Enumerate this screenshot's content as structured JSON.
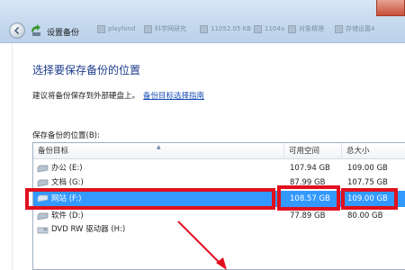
{
  "window": {
    "title": "设置备份",
    "taskbar_items": [
      "playfond",
      "科学网研究",
      "11052.05 KB",
      "1104a",
      "对象精理",
      "存储设置4"
    ]
  },
  "page": {
    "heading": "选择要保存备份的位置",
    "hint_text": "建议将备份保存到外部硬盘上。",
    "hint_link": "备份目标选择指南",
    "list_label": "保存备份的位置(B):"
  },
  "list": {
    "columns": [
      "备份目标",
      "可用空间",
      "总大小"
    ],
    "rows": [
      {
        "name": "办公 (E:)",
        "free": "107.94 GB",
        "total": "109.00 GB",
        "icon": "hard-drive-icon",
        "selected": false
      },
      {
        "name": "文档 (G:)",
        "free": "87.99 GB",
        "total": "107.75 GB",
        "icon": "hard-drive-icon",
        "selected": false
      },
      {
        "name": "网站 (F:)",
        "free": "108.57 GB",
        "total": "109.00 GB",
        "icon": "hard-drive-icon",
        "selected": true
      },
      {
        "name": "软件 (D:)",
        "free": "77.89 GB",
        "total": "80.00 GB",
        "icon": "hard-drive-icon",
        "selected": false
      },
      {
        "name": "DVD RW 驱动器 (H:)",
        "free": "",
        "total": "",
        "icon": "dvd-drive-icon",
        "selected": false
      }
    ]
  },
  "colors": {
    "heading": "#1e3c8c",
    "selection": "#3399ff",
    "annotation": "#e0101e"
  }
}
